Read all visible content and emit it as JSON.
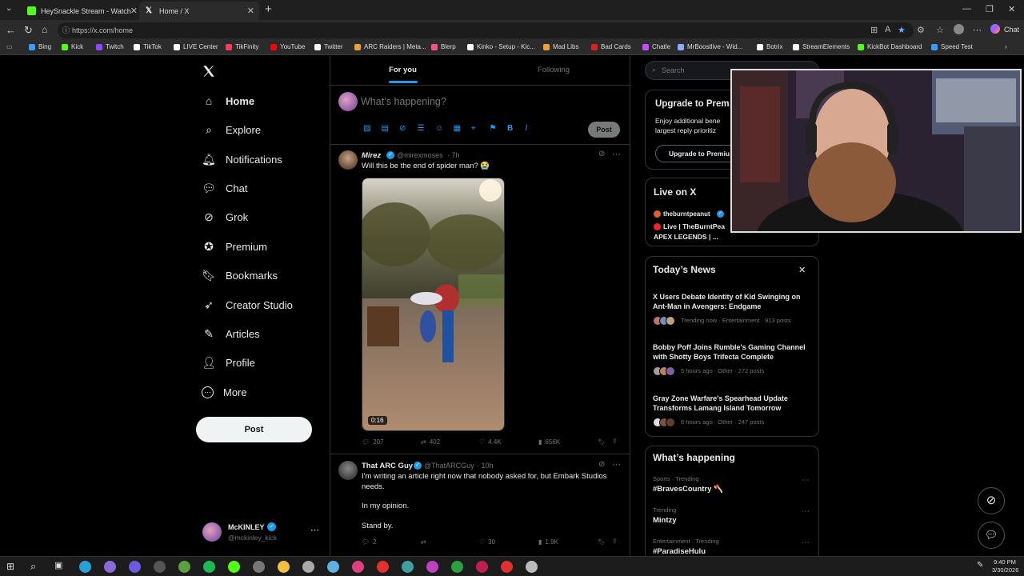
{
  "browser": {
    "tabs": [
      {
        "title": "HeySnackle Stream - Watch Live o",
        "active": false,
        "favicon_color": "#53fc18"
      },
      {
        "title": "Home / X",
        "active": true,
        "favicon_color": "#ffffff"
      }
    ],
    "new_tab_label": "+",
    "url": "https://x.com/home",
    "chat_label": "Chat",
    "bookmarks": [
      {
        "label": "Bing",
        "color": "#3b9cff"
      },
      {
        "label": "Kick",
        "color": "#53fc18"
      },
      {
        "label": "Twitch",
        "color": "#9146ff"
      },
      {
        "label": "TikTok",
        "color": "#ffffff"
      },
      {
        "label": "LIVE Center",
        "color": "#ffffff"
      },
      {
        "label": "TikFinity",
        "color": "#ff3b5c"
      },
      {
        "label": "YouTube",
        "color": "#ff0000"
      },
      {
        "label": "Twitter",
        "color": "#ffffff"
      },
      {
        "label": "ARC Raiders | Meta...",
        "color": "#f0a030"
      },
      {
        "label": "Blerp",
        "color": "#ff4f8b"
      },
      {
        "label": "Kinko - Setup - Kic...",
        "color": "#ffffff"
      },
      {
        "label": "Mad Libs",
        "color": "#f0a030"
      },
      {
        "label": "Bad Cards",
        "color": "#e02020"
      },
      {
        "label": "Chatle",
        "color": "#c04dff"
      },
      {
        "label": "MrBoostlive - Wid...",
        "color": "#88aaff"
      },
      {
        "label": "Botrix",
        "color": "#ffffff"
      },
      {
        "label": "StreamElements",
        "color": "#ffffff"
      },
      {
        "label": "KickBot Dashboard",
        "color": "#53fc18"
      },
      {
        "label": "Speed Test",
        "color": "#3b9cff"
      }
    ]
  },
  "sidebar": {
    "items": [
      {
        "label": "Home",
        "icon": "home-icon"
      },
      {
        "label": "Explore",
        "icon": "search-icon"
      },
      {
        "label": "Notifications",
        "icon": "bell-icon"
      },
      {
        "label": "Chat",
        "icon": "chat-icon"
      },
      {
        "label": "Grok",
        "icon": "grok-icon"
      },
      {
        "label": "Premium",
        "icon": "premium-icon"
      },
      {
        "label": "Bookmarks",
        "icon": "bookmark-icon"
      },
      {
        "label": "Creator Studio",
        "icon": "rocket-icon"
      },
      {
        "label": "Articles",
        "icon": "articles-icon"
      },
      {
        "label": "Profile",
        "icon": "person-icon"
      },
      {
        "label": "More",
        "icon": "more-circle-icon"
      }
    ],
    "post_label": "Post",
    "account": {
      "name": "McKINLEY",
      "handle": "@mckinley_kick"
    }
  },
  "feed": {
    "tabs": [
      {
        "label": "For you"
      },
      {
        "label": "Following"
      }
    ],
    "composer_placeholder": "What’s happening?",
    "composer_post_label": "Post",
    "tweets": [
      {
        "author": "Mirez",
        "handle": "@mirexmoses",
        "time": "· 7h",
        "text": "Will this be the end of spider man? 😭",
        "video_duration": "0:16",
        "replies": "207",
        "reposts": "402",
        "likes": "4.4K",
        "views": "656K"
      },
      {
        "author": "That ARC Guy",
        "handle": "@ThatARCGuy",
        "time": "· 10h",
        "text_lines": [
          "I'm writing an article right now that nobody asked for, but Embark Studios",
          "needs.",
          "In my opinion.",
          "Stand by."
        ],
        "replies": "2",
        "reposts": "",
        "likes": "30",
        "views": "1.9K"
      }
    ]
  },
  "right": {
    "search_placeholder": "Search",
    "premium": {
      "title": "Upgrade to Prem",
      "body_lines": [
        "Enjoy additional bene",
        "largest reply prioritiz"
      ],
      "button": "Upgrade to Premiu"
    },
    "live": {
      "title": "Live on X",
      "user": "theburntpeanut",
      "line1": "Live | TheBurntPea",
      "line2": "APEX LEGENDS | ..."
    },
    "news": {
      "title": "Today’s News",
      "items": [
        {
          "headline": "X Users Debate Identity of Kid Swinging on Ant-Man in Avengers: Endgame",
          "meta": "Trending now · Entertainment · 913 posts"
        },
        {
          "headline": "Bobby Poff Joins Rumble's Gaming Channel with Shotty Boys Trifecta Complete",
          "meta": "5 hours ago · Other · 272 posts"
        },
        {
          "headline": "Gray Zone Warfare's Spearhead Update Transforms Lamang Island Tomorrow",
          "meta": "6 hours ago · Other · 247 posts"
        }
      ]
    },
    "happening": {
      "title": "What’s happening",
      "trends": [
        {
          "meta": "Sports · Trending",
          "name": "#BravesCountry 🪓"
        },
        {
          "meta": "Trending",
          "name": "Mintzy"
        },
        {
          "meta": "Entertainment · Trending",
          "name": "#ParadiseHulu"
        }
      ]
    }
  },
  "taskbar": {
    "time": "9:40 PM",
    "date": "3/30/2026"
  }
}
